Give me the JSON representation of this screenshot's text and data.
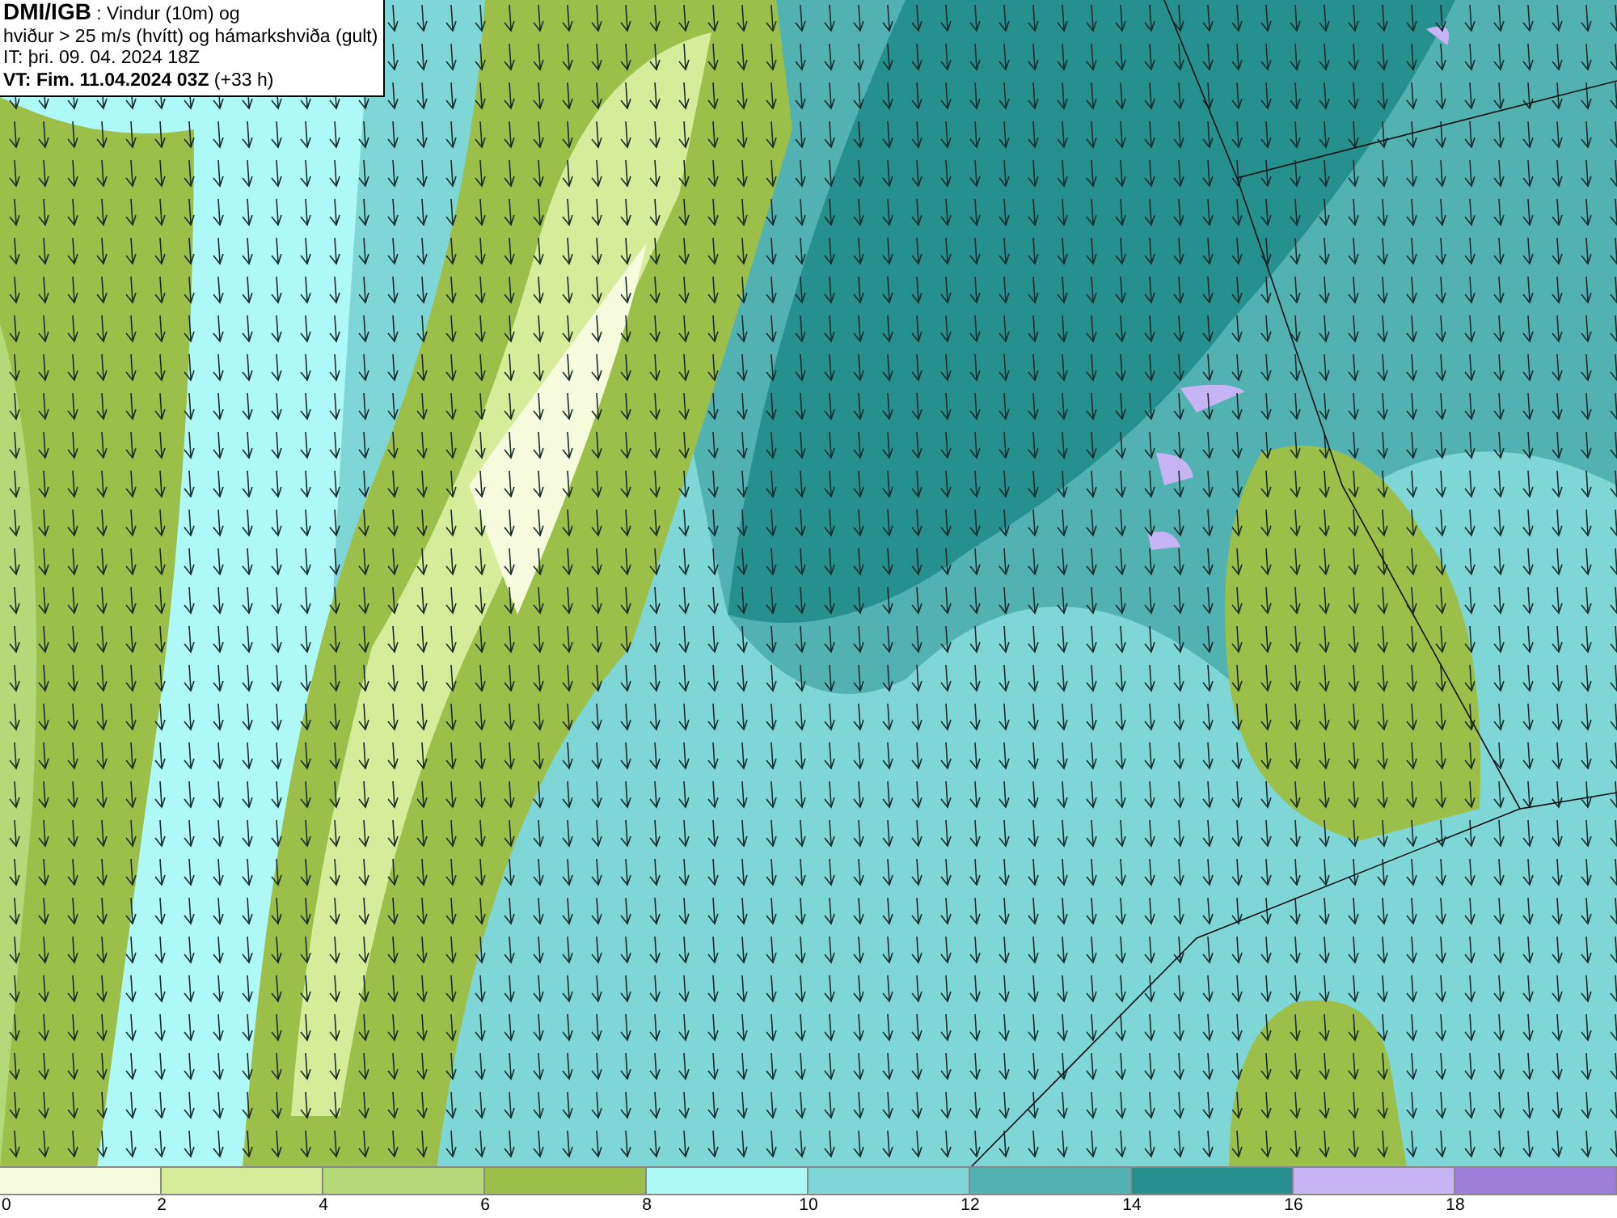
{
  "header": {
    "lines": [
      "**DMI/IGB** : Vindur (10m) og",
      "hviður > 25 m/s (hvítt) og hámarkshviða (gult)",
      "IT: þri. 09. 04. 2024 18Z",
      "**VT: Fim. 11.04.2024 03Z** (+33 h)"
    ]
  },
  "legend": [
    {
      "label": "0",
      "color": "#f5fbdc"
    },
    {
      "label": "2",
      "color": "#d6ec9a"
    },
    {
      "label": "4",
      "color": "#b5d978"
    },
    {
      "label": "6",
      "color": "#9cbf4a"
    },
    {
      "label": "8",
      "color": "#aef8f8"
    },
    {
      "label": "10",
      "color": "#7fd6d6"
    },
    {
      "label": "12",
      "color": "#52b2b2"
    },
    {
      "label": "14",
      "color": "#26908e"
    },
    {
      "label": "16",
      "color": "#c7b4f5"
    },
    {
      "label": "18",
      "color": "#9d7fdb"
    }
  ]
}
